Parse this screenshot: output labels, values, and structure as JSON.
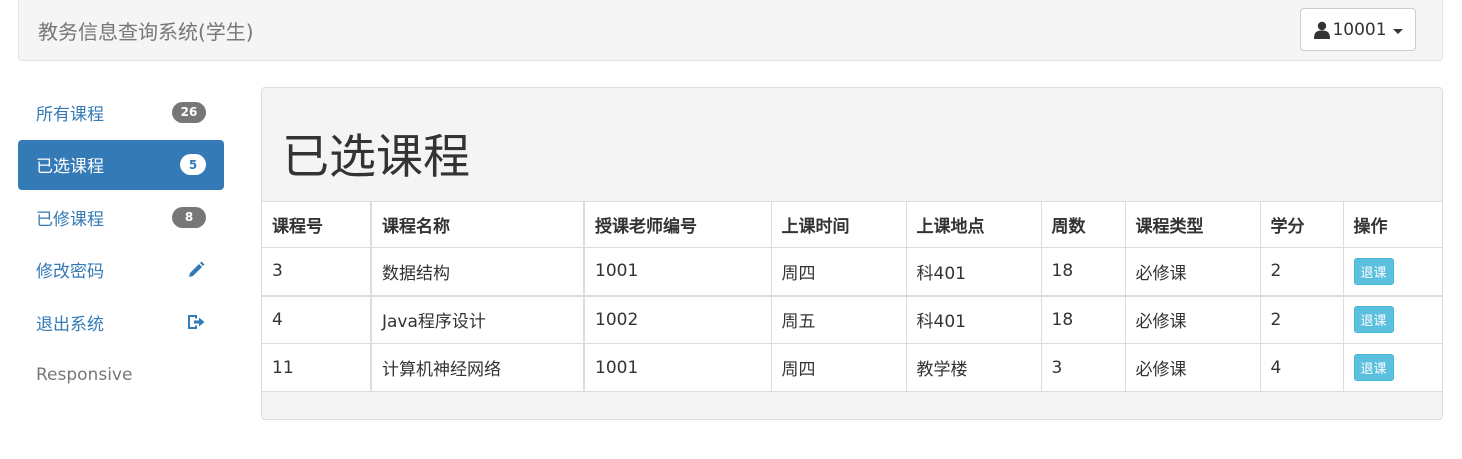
{
  "navbar": {
    "brand": "教务信息查询系统(学生)",
    "user_label": "10001",
    "user_icon": "user-icon"
  },
  "sidebar": {
    "items": [
      {
        "label": "所有课程",
        "badge": "26",
        "active": false
      },
      {
        "label": "已选课程",
        "badge": "5",
        "active": true
      },
      {
        "label": "已修课程",
        "badge": "8",
        "active": false
      },
      {
        "label": "修改密码",
        "icon": "pencil-icon"
      },
      {
        "label": "退出系统",
        "icon": "logout-icon"
      },
      {
        "label": "Responsive"
      }
    ]
  },
  "main": {
    "title": "已选课程",
    "table": {
      "headers": [
        "课程号",
        "课程名称",
        "授课老师编号",
        "上课时间",
        "上课地点",
        "周数",
        "课程类型",
        "学分",
        "操作"
      ],
      "rows": [
        [
          "3",
          "数据结构",
          "1001",
          "周四",
          "科401",
          "18",
          "必修课",
          "2",
          "退课"
        ],
        [
          "4",
          "Java程序设计",
          "1002",
          "周五",
          "科401",
          "18",
          "必修课",
          "2",
          "退课"
        ],
        [
          "11",
          "计算机神经网络",
          "1001",
          "周四",
          "教学楼",
          "3",
          "必修课",
          "4",
          "退课"
        ]
      ]
    }
  },
  "colors": {
    "primary": "#337ab7",
    "info": "#5bc0de",
    "badge": "#777777"
  }
}
